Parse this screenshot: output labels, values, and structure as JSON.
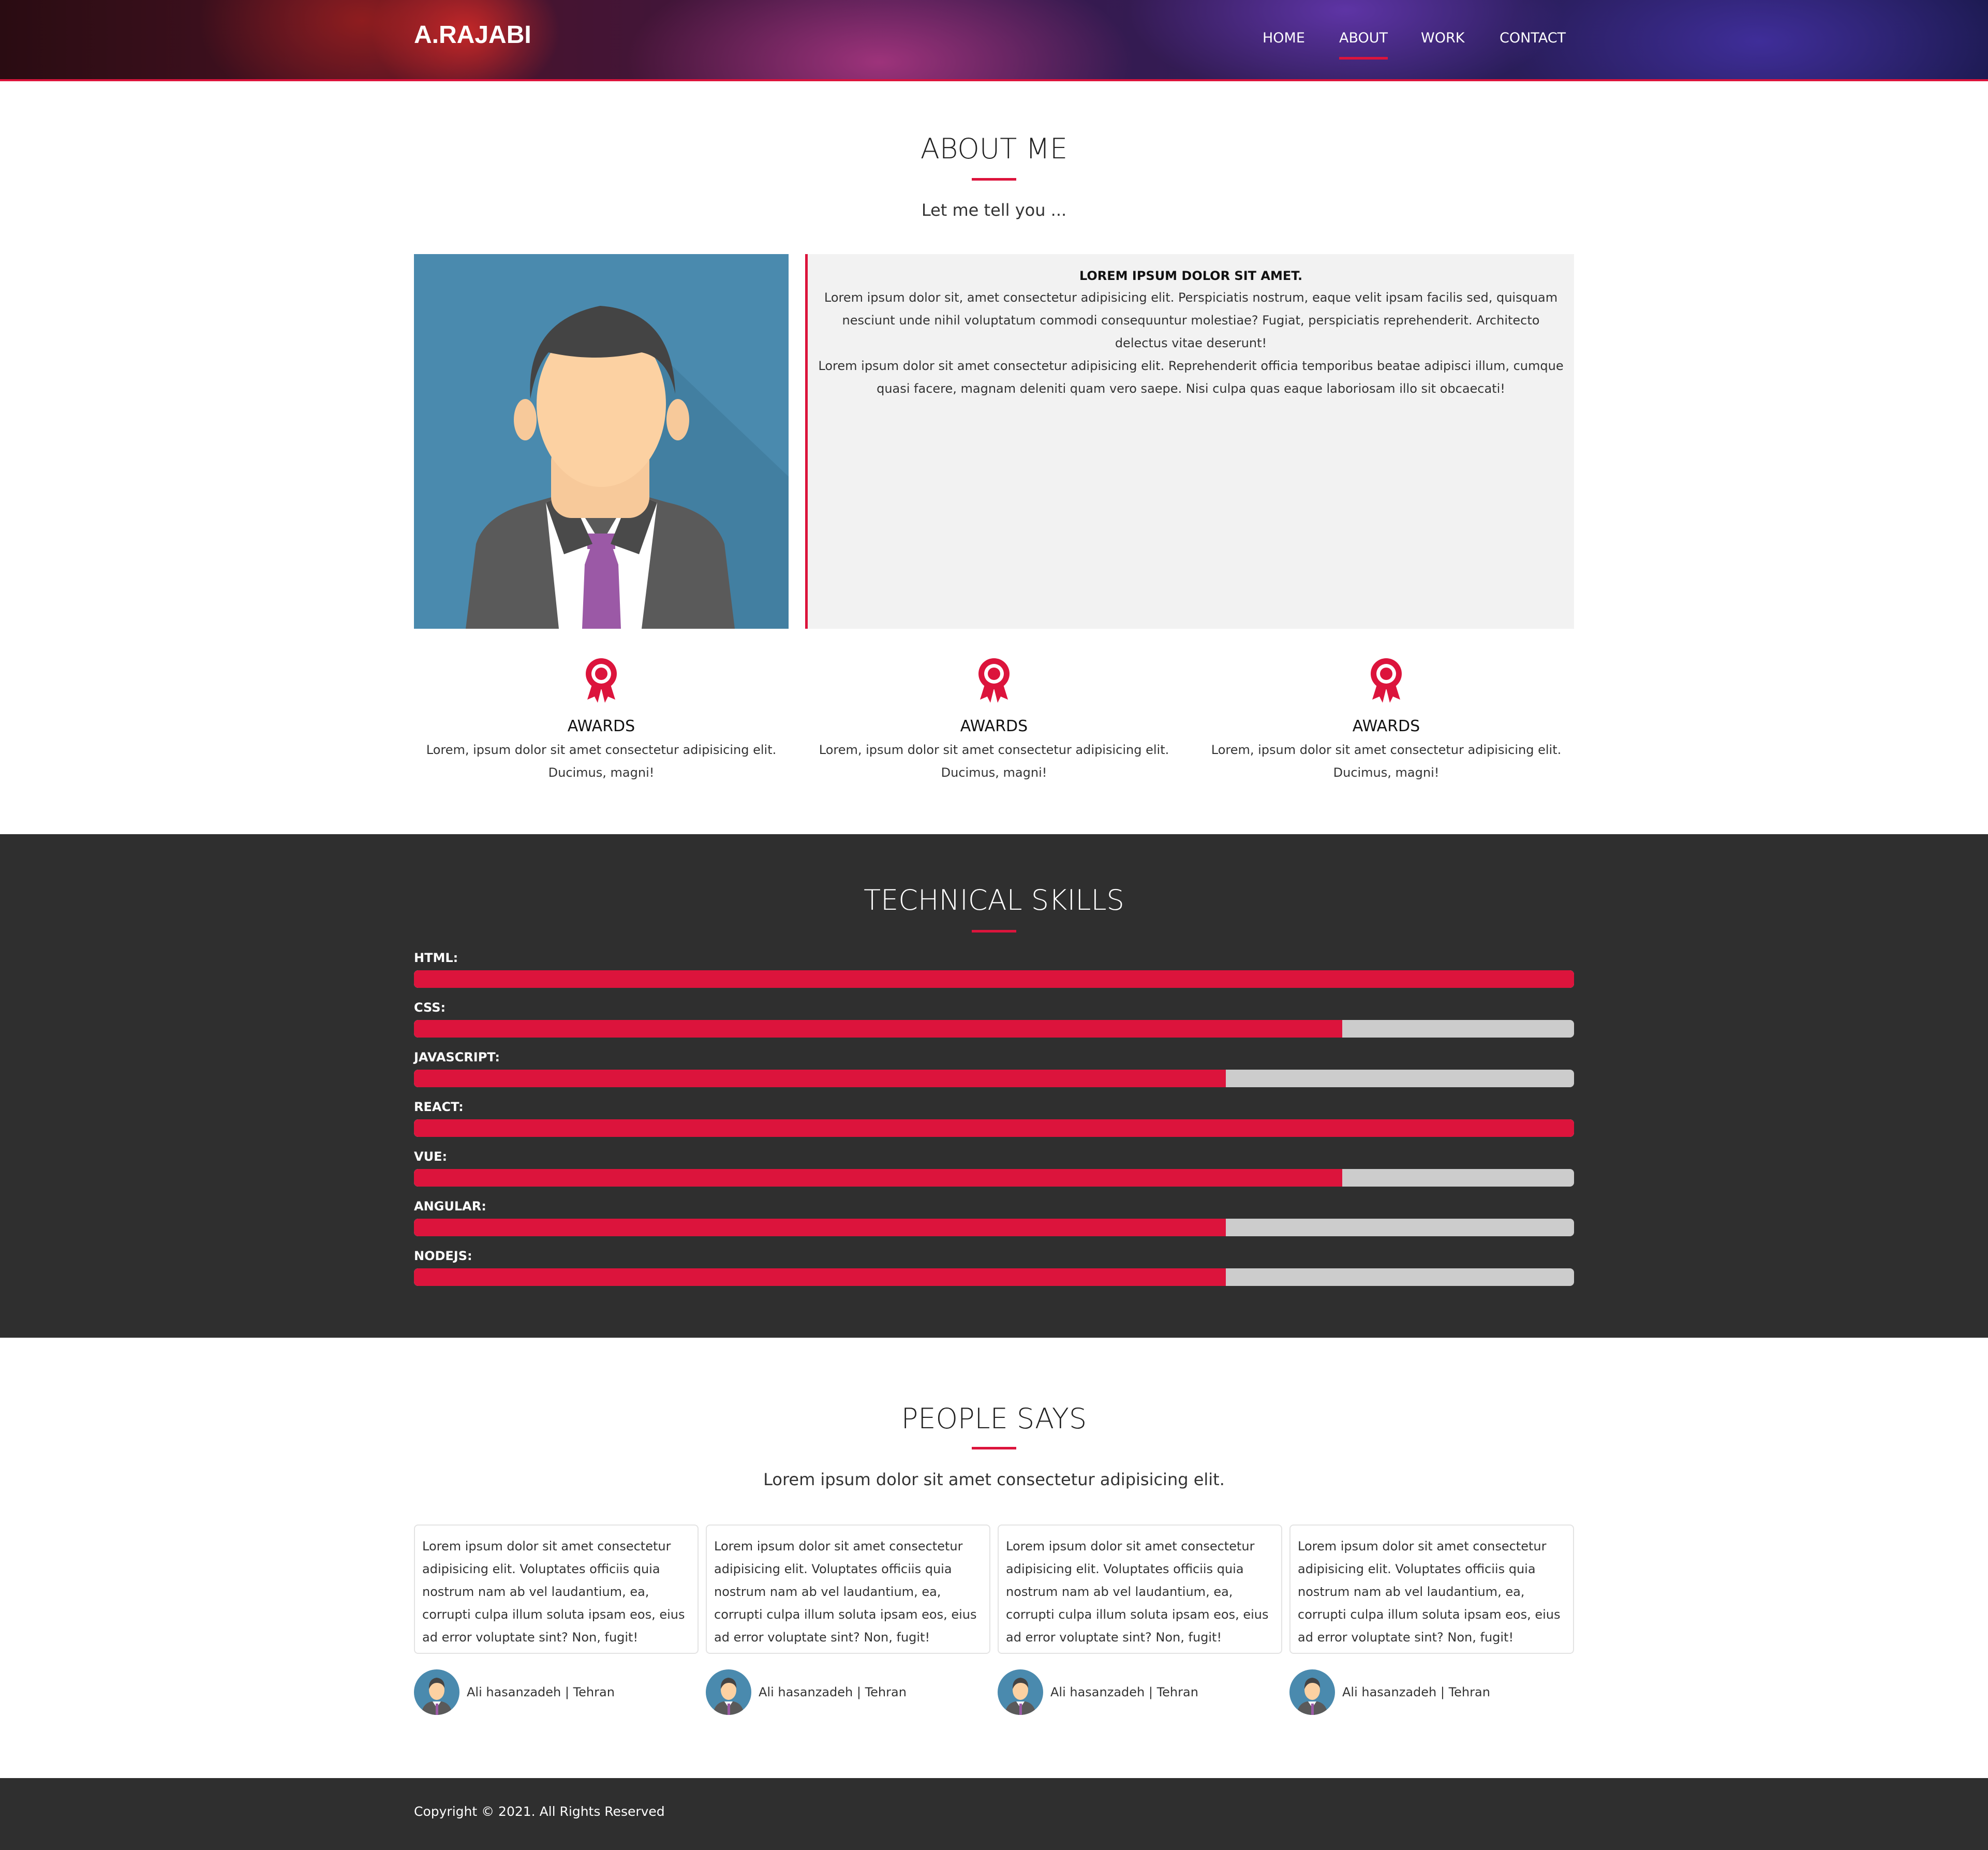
{
  "nav": {
    "brand": "A.RAJABI",
    "links": [
      "HOME",
      "ABOUT",
      "WORK",
      "CONTACT"
    ],
    "active": "ABOUT"
  },
  "about": {
    "title": "ABOUT ME",
    "subtitle": "Let me tell you ...",
    "card_heading": "LOREM IPSUM DOLOR SIT AMET.",
    "card_paragraph_1": "Lorem ipsum dolor sit, amet consectetur adipisicing elit. Perspiciatis nostrum, eaque velit ipsam facilis sed, quisquam nesciunt unde nihil voluptatum commodi consequuntur molestiae? Fugiat, perspiciatis reprehenderit. Architecto delectus vitae deserunt!",
    "card_paragraph_2": "Lorem ipsum dolor sit amet consectetur adipisicing elit. Reprehenderit officia temporibus beatae adipisci illum, cumque quasi facere, magnam deleniti quam vero saepe. Nisi culpa quas eaque laboriosam illo sit obcaecati!",
    "awards": [
      {
        "icon": "award-ribbon-icon",
        "title": "AWARDS",
        "text": "Lorem, ipsum dolor sit amet consectetur adipisicing elit. Ducimus, magni!"
      },
      {
        "icon": "award-ribbon-icon",
        "title": "AWARDS",
        "text": "Lorem, ipsum dolor sit amet consectetur adipisicing elit. Ducimus, magni!"
      },
      {
        "icon": "award-ribbon-icon",
        "title": "AWARDS",
        "text": "Lorem, ipsum dolor sit amet consectetur adipisicing elit. Ducimus, magni!"
      }
    ]
  },
  "skills": {
    "title": "TECHNICAL SKILLS",
    "items": [
      {
        "label": "HTML:",
        "percent": 100
      },
      {
        "label": "CSS:",
        "percent": 80
      },
      {
        "label": "JAVASCRIPT:",
        "percent": 70
      },
      {
        "label": "REACT:",
        "percent": 100
      },
      {
        "label": "VUE:",
        "percent": 80
      },
      {
        "label": "ANGULAR:",
        "percent": 70
      },
      {
        "label": "NODEJS:",
        "percent": 70
      }
    ]
  },
  "testimonials": {
    "title": "PEOPLE SAYS",
    "subtitle": "Lorem ipsum dolor sit amet consectetur adipisicing elit.",
    "items": [
      {
        "quote": "Lorem ipsum dolor sit amet consectetur adipisicing elit. Voluptates officiis quia nostrum nam ab vel laudantium, ea, corrupti culpa illum soluta ipsam eos, eius ad error voluptate sint? Non, fugit!",
        "author": "Ali hasanzadeh | Tehran"
      },
      {
        "quote": "Lorem ipsum dolor sit amet consectetur adipisicing elit. Voluptates officiis quia nostrum nam ab vel laudantium, ea, corrupti culpa illum soluta ipsam eos, eius ad error voluptate sint? Non, fugit!",
        "author": "Ali hasanzadeh | Tehran"
      },
      {
        "quote": "Lorem ipsum dolor sit amet consectetur adipisicing elit. Voluptates officiis quia nostrum nam ab vel laudantium, ea, corrupti culpa illum soluta ipsam eos, eius ad error voluptate sint? Non, fugit!",
        "author": "Ali hasanzadeh | Tehran"
      },
      {
        "quote": "Lorem ipsum dolor sit amet consectetur adipisicing elit. Voluptates officiis quia nostrum nam ab vel laudantium, ea, corrupti culpa illum soluta ipsam eos, eius ad error voluptate sint? Non, fugit!",
        "author": "Ali hasanzadeh | Tehran"
      }
    ]
  },
  "footer": {
    "copyright": "Copyright © 2021. All Rights Reserved"
  },
  "colors": {
    "accent": "#dc143c",
    "dark_bg": "#2f2f2f",
    "card_bg": "#f2f2f2",
    "track": "#cccccc",
    "avatar_bg": "#4a8aae"
  }
}
